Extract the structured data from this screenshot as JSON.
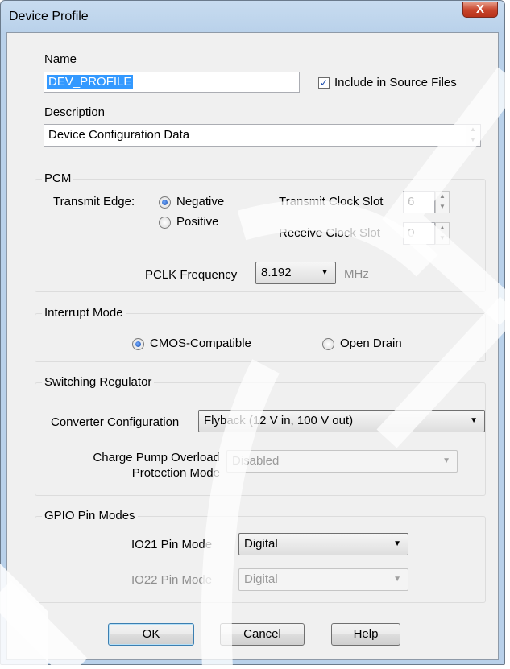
{
  "window": {
    "title": "Device Profile",
    "close_glyph": "X"
  },
  "name_section": {
    "name_label": "Name",
    "name_value": "DEV_PROFILE",
    "include_label": "Include in Source Files",
    "include_checked": true,
    "description_label": "Description",
    "description_value": "Device Configuration Data"
  },
  "pcm": {
    "title": "PCM",
    "transmit_edge_label": "Transmit Edge:",
    "negative_label": "Negative",
    "positive_label": "Positive",
    "selected_edge": "Negative",
    "transmit_slot_label": "Transmit Clock Slot",
    "transmit_slot_value": "6",
    "receive_slot_label": "Receive Clock Slot",
    "receive_slot_value": "0",
    "pclk_label": "PCLK Frequency",
    "pclk_value": "8.192",
    "pclk_unit": "MHz"
  },
  "interrupt": {
    "title": "Interrupt Mode",
    "cmos_label": "CMOS-Compatible",
    "open_drain_label": "Open Drain",
    "selected": "CMOS-Compatible"
  },
  "switching": {
    "title": "Switching Regulator",
    "converter_label": "Converter Configuration",
    "converter_value": "Flyback (12 V in, 100 V out)",
    "charge_pump_label_line1": "Charge Pump Overload",
    "charge_pump_label_line2": "Protection Mode",
    "charge_pump_value": "Disabled"
  },
  "gpio": {
    "title": "GPIO Pin Modes",
    "io21_label": "IO21 Pin Mode",
    "io21_value": "Digital",
    "io22_label": "IO22 Pin Mode",
    "io22_value": "Digital"
  },
  "buttons": {
    "ok": "OK",
    "cancel": "Cancel",
    "help": "Help"
  },
  "colors": {
    "selection_bg": "#3399ff",
    "accent_radio": "#1d4ea8",
    "close_button": "#c8452b"
  }
}
